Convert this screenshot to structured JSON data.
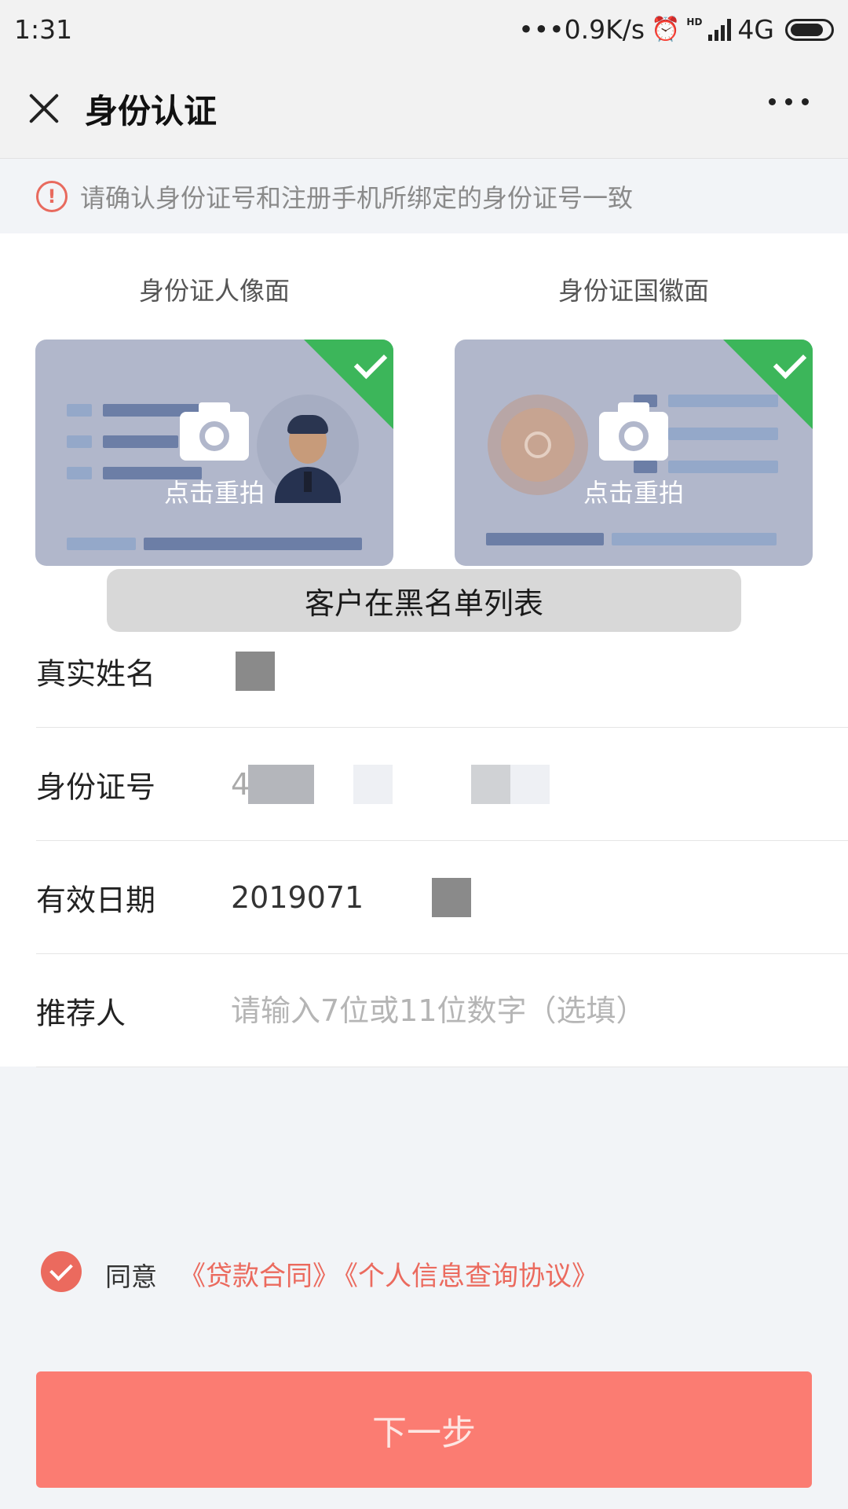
{
  "status_bar": {
    "time": "1:31",
    "network_speed": "•••0.9K/s",
    "alarm_icon": "alarm-clock-icon",
    "hd_label": "HD",
    "network_type": "4G",
    "battery_level": 0.85
  },
  "nav": {
    "title": "身份认证",
    "close_icon": "close-icon",
    "more_icon": "more-dots-icon"
  },
  "notice": {
    "icon": "!",
    "text": "请确认身份证号和注册手机所绑定的身份证号一致"
  },
  "id_cards": {
    "front": {
      "label": "身份证人像面",
      "action": "点击重拍"
    },
    "back": {
      "label": "身份证国徽面",
      "action": "点击重拍"
    }
  },
  "toast": {
    "text": "客户在黑名单列表"
  },
  "form": {
    "name_label": "真实姓名",
    "id_label": "身份证号",
    "id_value_visible": "4",
    "date_label": "有效日期",
    "date_value_visible": "2019071",
    "referrer_label": "推荐人",
    "referrer_placeholder": "请输入7位或11位数字（选填）"
  },
  "agreement": {
    "agree_label": "同意",
    "loan_contract": "《贷款合同》",
    "info_query": "《个人信息查询协议》"
  },
  "next_button": {
    "label": "下一步"
  },
  "colors": {
    "accent": "#eb6a5e",
    "primary_button": "#fb7c72",
    "success": "#3cb65a",
    "card_bg": "#b1b7cb"
  }
}
